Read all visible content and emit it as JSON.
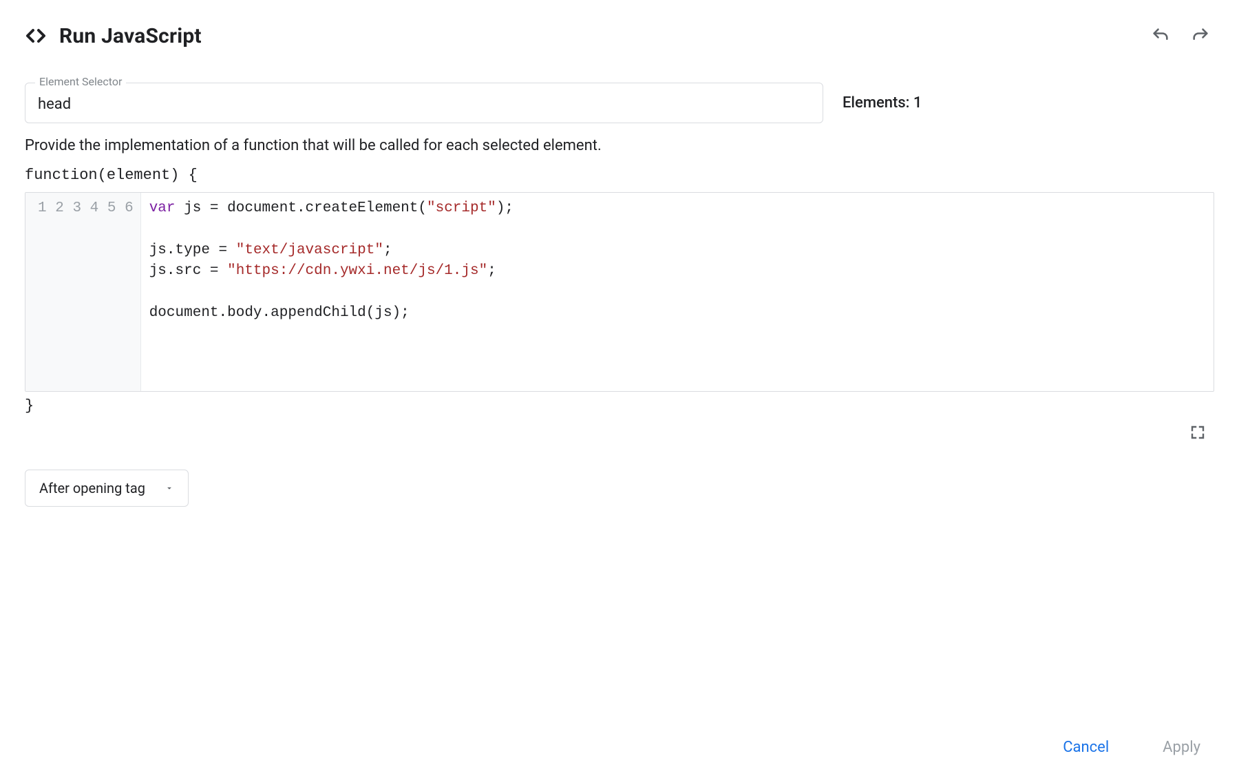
{
  "header": {
    "title": "Run JavaScript"
  },
  "selector": {
    "label": "Element Selector",
    "value": "head",
    "count_label": "Elements: 1"
  },
  "description": "Provide the implementation of a function that will be called for each selected element.",
  "function_signature": "function(element) {",
  "closing_brace": "}",
  "code": {
    "line_numbers": [
      "1",
      "2",
      "3",
      "4",
      "5",
      "6"
    ],
    "l1_kw": "var",
    "l1_rest_a": " js = document.createElement(",
    "l1_str": "\"script\"",
    "l1_rest_b": ");",
    "l3_a": "js.type = ",
    "l3_str": "\"text/javascript\"",
    "l3_b": ";",
    "l4_a": "js.src = ",
    "l4_str": "\"https://cdn.ywxi.net/js/1.js\"",
    "l4_b": ";",
    "l6": "document.body.appendChild(js);"
  },
  "position_select": {
    "value": "After opening tag"
  },
  "footer": {
    "cancel": "Cancel",
    "apply": "Apply"
  }
}
